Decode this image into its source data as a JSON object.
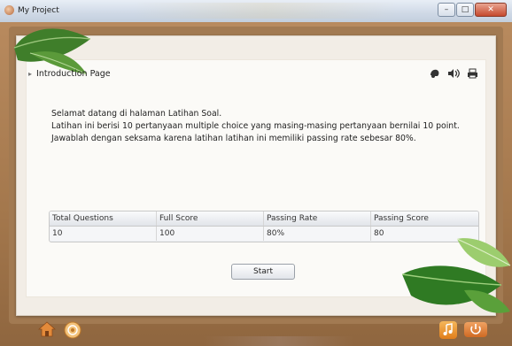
{
  "window": {
    "title": "My Project",
    "app_icon": "app-icon",
    "controls": [
      "minimize-icon",
      "maximize-icon",
      "close-icon"
    ]
  },
  "page": {
    "header": "Introduction Page",
    "tools": [
      "audio-icon",
      "speaker-icon",
      "print-icon"
    ]
  },
  "intro": {
    "lines": [
      "Selamat datang di halaman Latihan Soal.",
      "Latihan ini berisi 10 pertanyaan multiple choice yang masing-masing pertanyaan bernilai 10 point.",
      "Jawablah dengan seksama karena latihan latihan ini memiliki passing rate sebesar 80%."
    ]
  },
  "stats": {
    "headers": [
      "Total Questions",
      "Full Score",
      "Passing Rate",
      "Passing Score"
    ],
    "values": [
      "10",
      "100",
      "80%",
      "80"
    ]
  },
  "start_label": "Start",
  "footer": {
    "left_icons": [
      "home-icon",
      "cd-icon"
    ],
    "right_icons": [
      "music-icon",
      "power-icon"
    ]
  },
  "colors": {
    "wood": "#a3774c",
    "paper": "#f2ede6",
    "accent_orange": "#e07e1b"
  }
}
